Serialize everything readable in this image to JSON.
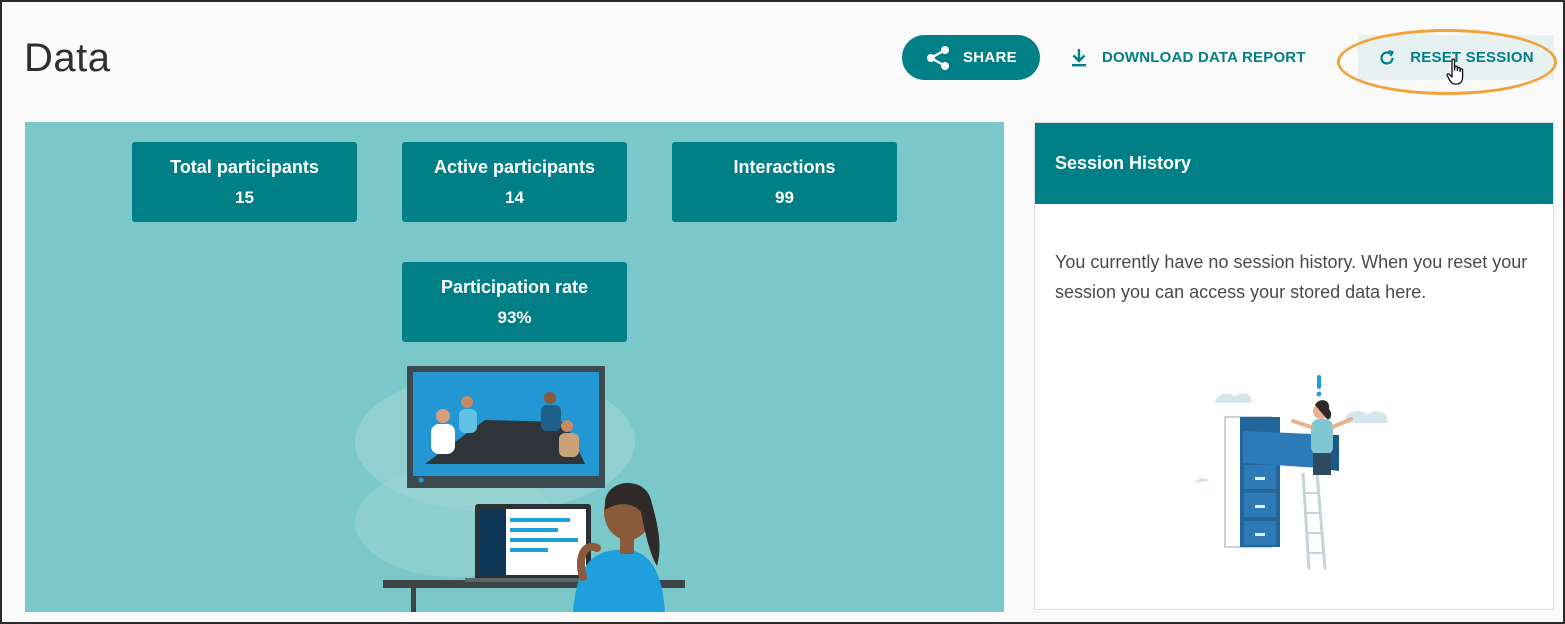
{
  "page": {
    "title": "Data"
  },
  "toolbar": {
    "share_label": "SHARE",
    "download_label": "DOWNLOAD DATA REPORT",
    "reset_label": "RESET SESSION",
    "share_icon": "share-icon",
    "download_icon": "download-icon",
    "reset_icon": "refresh-icon"
  },
  "stats": [
    {
      "label": "Total participants",
      "value": "15"
    },
    {
      "label": "Active participants",
      "value": "14"
    },
    {
      "label": "Interactions",
      "value": "99"
    },
    {
      "label": "Participation rate",
      "value": "93%"
    }
  ],
  "session_history": {
    "title": "Session History",
    "empty_message": "You currently have no session history. When you reset your session you can access your stored data here."
  },
  "colors": {
    "accent": "#007f86",
    "teal_background": "#7ac8c9",
    "highlight": "#f0a23c"
  }
}
